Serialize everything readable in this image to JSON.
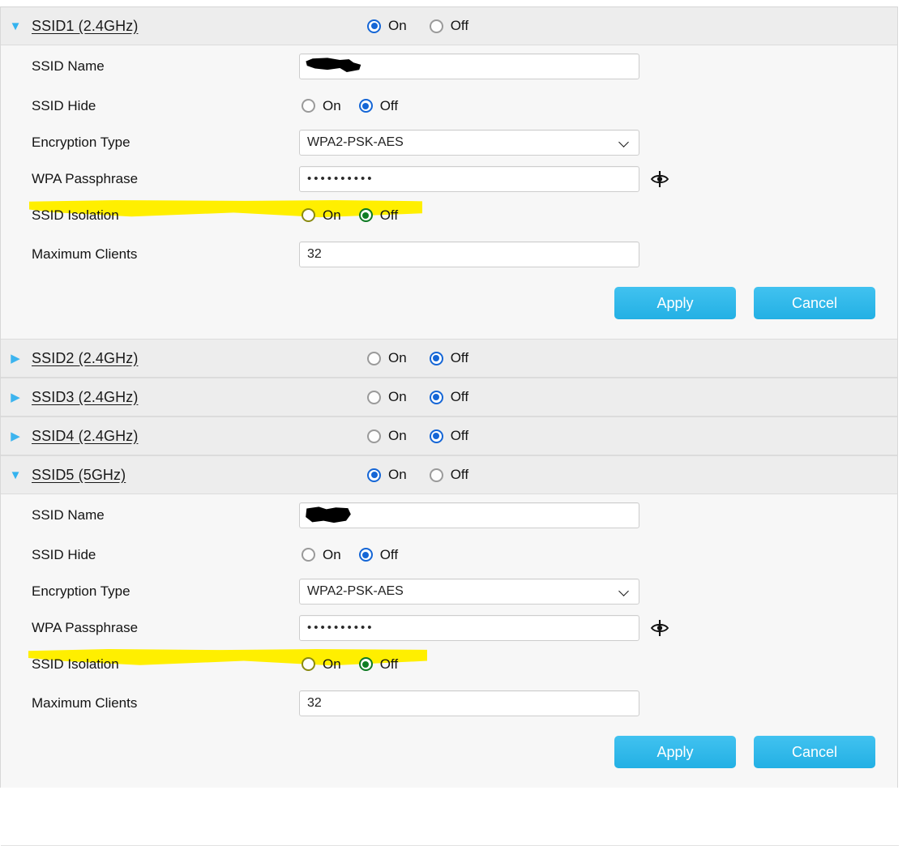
{
  "radio_labels": {
    "on": "On",
    "off": "Off"
  },
  "icons": {
    "expanded": "expand-triangle-down-icon",
    "collapsed": "expand-triangle-right-icon",
    "glyph_expanded": "▼",
    "glyph_collapsed": "▶",
    "select_arrow": "chevron-down-icon",
    "password_toggle": "eye-slash-icon"
  },
  "colors": {
    "accent_blue": "#1566d6",
    "link_teal": "#34b3ef",
    "button_blue": "#29b4e6",
    "highlight_yellow": "#ffef00",
    "highlight_radio_green": "#0f7d24",
    "header_bg": "#ededed",
    "body_bg": "#f7f7f7"
  },
  "fields": {
    "ssid_name": "SSID Name",
    "ssid_hide": "SSID Hide",
    "encryption_type": "Encryption Type",
    "wpa_passphrase": "WPA Passphrase",
    "ssid_isolation": "SSID Isolation",
    "maximum_clients": "Maximum Clients"
  },
  "buttons": {
    "apply": "Apply",
    "cancel": "Cancel"
  },
  "sections": [
    {
      "title": "SSID1 (2.4GHz)",
      "enabled": "On",
      "expanded": true,
      "values": {
        "ssid_name": "",
        "ssid_name_redacted": true,
        "ssid_hide": "Off",
        "encryption_type": "WPA2-PSK-AES",
        "wpa_passphrase": "••••••••••",
        "ssid_isolation": "Off",
        "maximum_clients": "32"
      }
    },
    {
      "title": "SSID2 (2.4GHz)",
      "enabled": "Off",
      "expanded": false
    },
    {
      "title": "SSID3 (2.4GHz)",
      "enabled": "Off",
      "expanded": false
    },
    {
      "title": "SSID4 (2.4GHz)",
      "enabled": "Off",
      "expanded": false
    },
    {
      "title": "SSID5 (5GHz)",
      "enabled": "On",
      "expanded": true,
      "values": {
        "ssid_name": "",
        "ssid_name_redacted": true,
        "ssid_hide": "Off",
        "encryption_type": "WPA2-PSK-AES",
        "wpa_passphrase": "••••••••••",
        "ssid_isolation": "Off",
        "maximum_clients": "32"
      }
    }
  ]
}
